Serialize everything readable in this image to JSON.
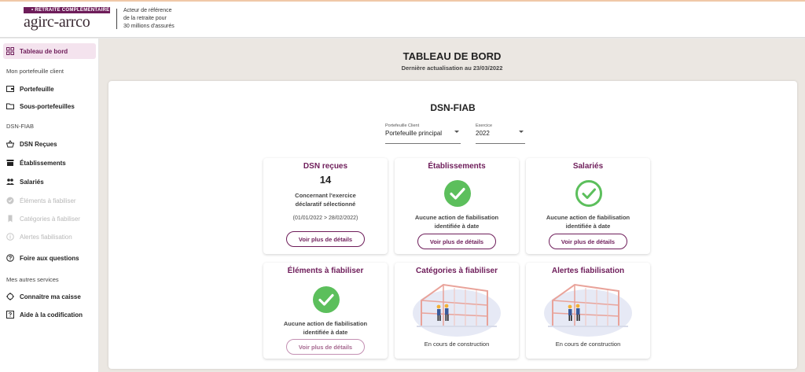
{
  "header": {
    "brand_band": "• RETRAITE COMPLÉMENTAIRE",
    "brand_name": "agirc-arrco",
    "tagline_1": "Acteur de référence",
    "tagline_2": "de la retraite pour",
    "tagline_3": "30 millions d'assurés"
  },
  "sidebar": {
    "dashboard": "Tableau de bord",
    "section_portfolio": "Mon portefeuille client",
    "portfolio": "Portefeuille",
    "sub_portfolios": "Sous-portefeuilles",
    "section_dsn": "DSN-FIAB",
    "dsn_received": "DSN Reçues",
    "establishments": "Établissements",
    "employees": "Salariés",
    "elements": "Éléments à fiabiliser",
    "categories": "Catégories à fiabiliser",
    "alerts": "Alertes fiabilisation",
    "faq": "Foire aux questions",
    "section_services": "Mes autres services",
    "know_fund": "Connaitre ma caisse",
    "coding_help": "Aide à la codification"
  },
  "main": {
    "title": "TABLEAU DE BORD",
    "subtitle": "Dernière actualisation au 23/03/2022",
    "panel_title": "DSN-FIAB",
    "portfolio_select": {
      "label": "Portefeuille Client",
      "value": "Portefeuille principal"
    },
    "year_select": {
      "label": "Exercice",
      "value": "2022"
    }
  },
  "cards": {
    "dsn": {
      "title": "DSN reçues",
      "count": "14",
      "text_1": "Concernant l'exercice",
      "text_2": "déclaratif sélectionné",
      "range": "(01/01/2022 > 28/02/2022)",
      "button": "Voir plus de détails"
    },
    "establishments": {
      "title": "Établissements",
      "text_1": "Aucune action de fiabilisation",
      "text_2": "identifiée à date",
      "button": "Voir plus de détails"
    },
    "employees": {
      "title": "Salariés",
      "text_1": "Aucune action de fiabilisation",
      "text_2": "identifiée à date",
      "button": "Voir plus de détails"
    },
    "elements": {
      "title": "Éléments à fiabiliser",
      "text_1": "Aucune action de fiabilisation",
      "text_2": "identifiée à date",
      "button": "Voir plus de détails"
    },
    "categories": {
      "title": "Catégories à fiabiliser",
      "status": "En cours de construction"
    },
    "alerts": {
      "title": "Alertes fiabilisation",
      "status": "En cours de construction"
    }
  },
  "colors": {
    "brand": "#6e1d5a",
    "success": "#5cbf5c",
    "active_bg": "#f4e3ee"
  },
  "icons": {
    "dashboard": "grid-icon",
    "portfolio": "wallet-icon",
    "sub_portfolios": "folder-icon",
    "dsn_received": "basket-icon",
    "establishments": "store-icon",
    "employees": "people-icon",
    "elements": "check-circle-icon",
    "categories": "bookmark-icon",
    "alerts": "info-icon",
    "faq": "help-icon",
    "know_fund": "target-icon",
    "coding_help": "help-square-icon"
  }
}
